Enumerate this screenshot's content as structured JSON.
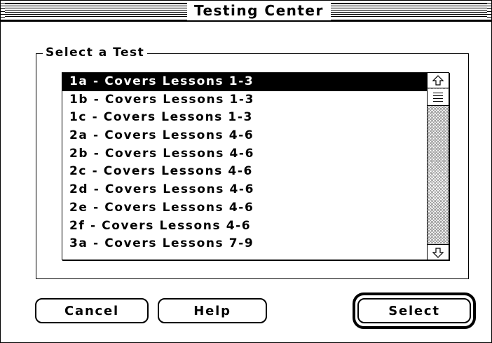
{
  "window": {
    "title": "Testing Center"
  },
  "group": {
    "label": "Select a Test"
  },
  "tests": {
    "selected_index": 0,
    "items": [
      "1a - Covers Lessons 1-3",
      "1b - Covers Lessons 1-3",
      "1c - Covers Lessons 1-3",
      "2a - Covers Lessons 4-6",
      "2b - Covers Lessons 4-6",
      "2c - Covers Lessons 4-6",
      "2d - Covers Lessons 4-6",
      "2e - Covers Lessons 4-6",
      "2f - Covers Lessons 4-6",
      "3a - Covers Lessons 7-9"
    ]
  },
  "scrollbar": {
    "up_icon": "arrow-up-icon",
    "down_icon": "arrow-down-icon"
  },
  "buttons": {
    "cancel": "Cancel",
    "help": "Help",
    "select": "Select",
    "default": "select"
  }
}
